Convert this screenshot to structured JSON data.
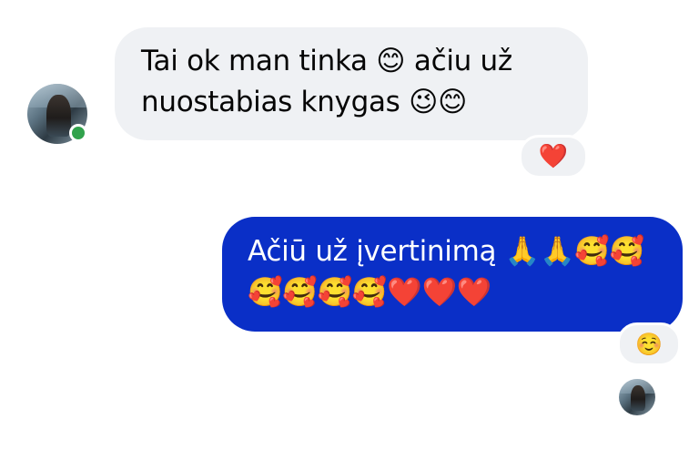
{
  "incoming_message": {
    "text": "Tai ok man tinka 😊 ačiu už nuostabias knygas 😉😊",
    "reaction": "❤️"
  },
  "outgoing_message": {
    "text": "Ačiū už įvertinimą 🙏🙏🥰🥰🥰🥰🥰🥰❤️❤️❤️",
    "reaction": "☺️"
  },
  "contact": {
    "avatar_icon": "user-avatar-icon",
    "online_indicator_color": "#31a24c"
  },
  "read_receipt": {
    "avatar_icon": "seen-avatar-icon"
  },
  "colors": {
    "incoming_bubble": "#eff1f4",
    "outgoing_bubble": "#0a2fc7",
    "background": "#ffffff"
  }
}
